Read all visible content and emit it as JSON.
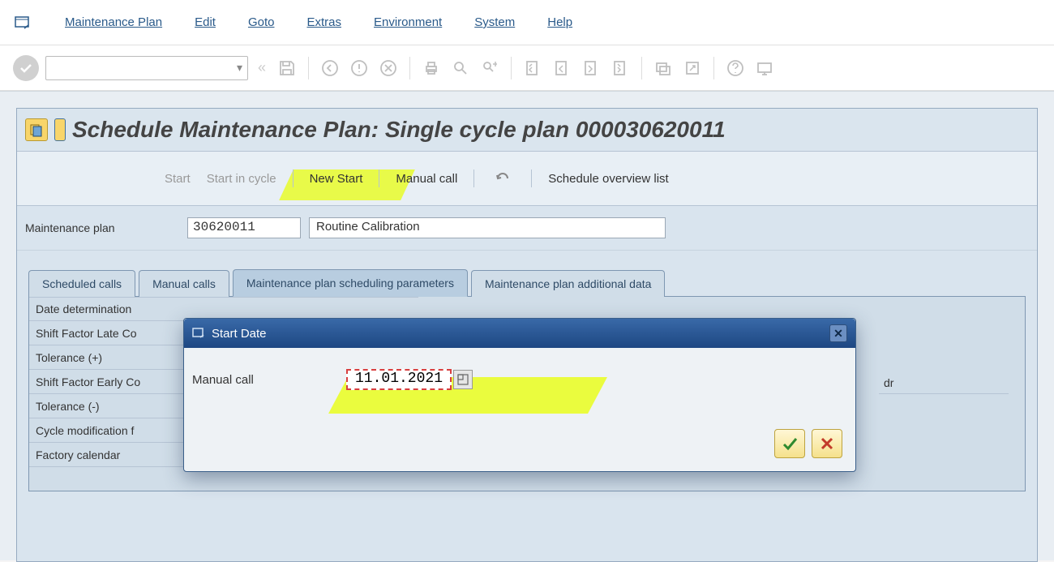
{
  "menu": {
    "items": [
      "Maintenance Plan",
      "Edit",
      "Goto",
      "Extras",
      "Environment",
      "System",
      "Help"
    ]
  },
  "toolbar": {
    "tcode_value": "",
    "icons": [
      "save-icon",
      "back-icon",
      "exit-icon",
      "cancel-icon",
      "print-icon",
      "find-icon",
      "find-next-icon",
      "first-page-icon",
      "prev-page-icon",
      "next-page-icon",
      "last-page-icon",
      "create-session-icon",
      "generate-shortcut-icon",
      "help-icon",
      "layout-icon"
    ]
  },
  "title": "Schedule Maintenance Plan: Single cycle plan 000030620011",
  "action_bar": {
    "start": "Start",
    "start_in_cycle": "Start in cycle",
    "new_start": "New Start",
    "manual_call": "Manual call",
    "schedule_overview": "Schedule overview list"
  },
  "plan": {
    "label": "Maintenance plan",
    "id": "30620011",
    "description": "Routine Calibration"
  },
  "tabs": {
    "scheduled_calls": "Scheduled calls",
    "manual_calls": "Manual calls",
    "scheduling_params": "Maintenance plan scheduling parameters",
    "additional_data": "Maintenance plan additional data"
  },
  "params": {
    "date_determination": "Date determination",
    "shift_late": "Shift Factor Late Co",
    "tolerance_plus": "Tolerance (+)",
    "shift_early": "Shift Factor Early Co",
    "tolerance_minus": "Tolerance (-)",
    "cycle_mod": "Cycle modification f",
    "factory_calendar": "Factory calendar"
  },
  "right_hint": "dr",
  "dialog": {
    "title": "Start Date",
    "field_label": "Manual call",
    "date_value": "11.01.2021",
    "ok": "✓",
    "cancel": "✕",
    "close": "✕"
  }
}
